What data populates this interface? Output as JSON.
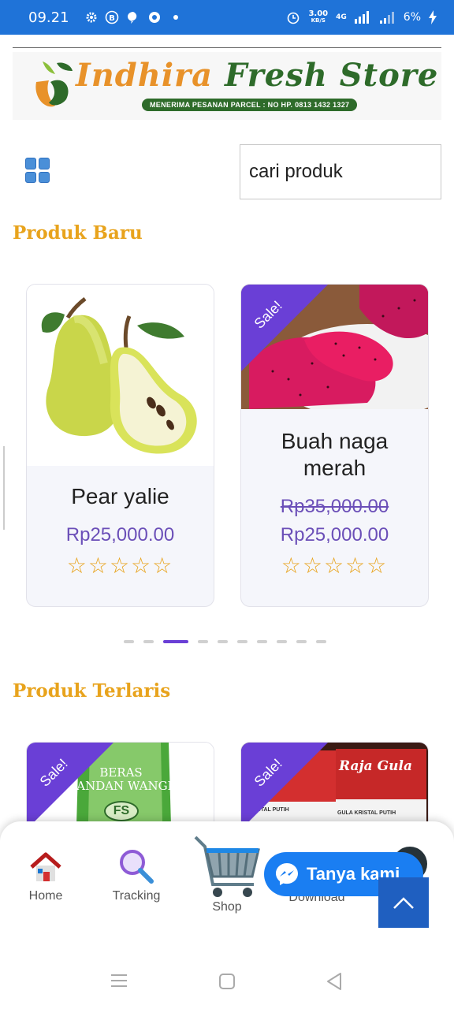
{
  "status_bar": {
    "time": "09.21",
    "net_speed_value": "3.00",
    "net_speed_unit": "KB/S",
    "network": "4G",
    "battery": "6%"
  },
  "header": {
    "logo_title_part1": "Indhira",
    "logo_title_part2": "Fresh Store",
    "logo_subtitle": "MENERIMA PESANAN PARCEL : NO HP. 0813 1432 1327"
  },
  "search": {
    "placeholder": "cari produk"
  },
  "sections": {
    "new": {
      "title": "Produk Baru",
      "products": [
        {
          "name": "Pear yalie",
          "price": "Rp25,000.00",
          "rating": 0
        },
        {
          "name": "Buah naga merah",
          "old_price": "Rp35,000.00",
          "price": "Rp25,000.00",
          "badge": "Sale!",
          "rating": 0
        }
      ],
      "carousel": {
        "total_dots": 10,
        "active_index": 2
      }
    },
    "bestsellers": {
      "title": "Produk Terlaris",
      "products": [
        {
          "badge": "Sale!",
          "label_line1": "BERAS",
          "label_line2": "PANDAN WANGI",
          "label_line3": "FS"
        },
        {
          "badge": "Sale!",
          "label_line1": "Raja Gula",
          "label_line2": "KRISTAL PUTIH",
          "label_line3": "GULA KRISTAL PUTIH"
        }
      ]
    }
  },
  "stars": "☆☆☆☆☆",
  "bottom_nav": {
    "items": [
      {
        "label": "Home",
        "icon": "home-icon"
      },
      {
        "label": "Tracking",
        "icon": "magnifier-icon"
      },
      {
        "label": "Shop",
        "icon": "cart-icon"
      },
      {
        "label": "Download",
        "icon": "download-icon"
      }
    ]
  },
  "chat": {
    "label": "Tanya kami",
    "icon": "messenger-icon"
  },
  "colors": {
    "status_bar": "#1f73d8",
    "section_title": "#e8a31c",
    "price": "#6b4fb8",
    "sale_badge": "#6a3fd6",
    "chat_button": "#1a7ef2",
    "scroll_top": "#1f5fc0"
  }
}
